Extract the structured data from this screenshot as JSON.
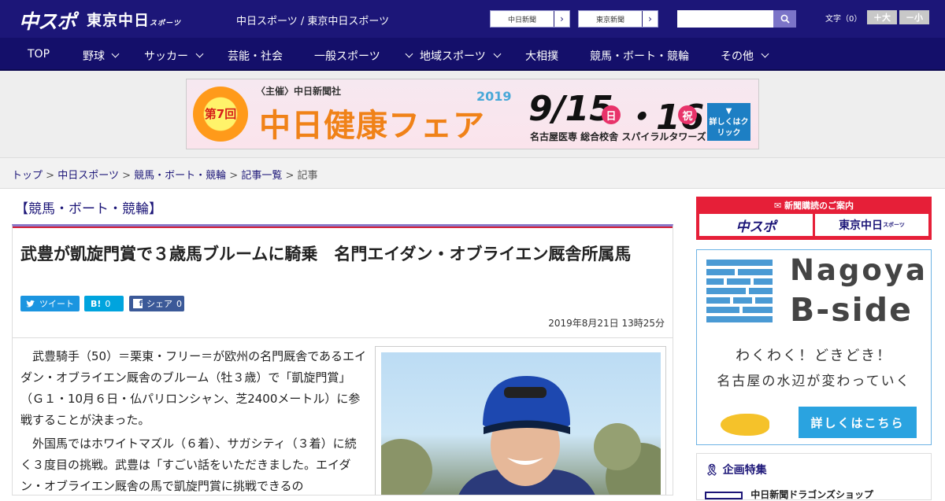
{
  "header": {
    "logo_chuspo": "中スポ",
    "logo_tokyo": "東京中日",
    "logo_tokyo_small": "スポーツ",
    "site_title": "中日スポーツ / 東京中日スポーツ",
    "paper_links": [
      "中日新聞",
      "東京新聞"
    ],
    "search_placeholder": "",
    "font_size_label": "文字（0）",
    "font_larger": "＋大",
    "font_smaller": "－小"
  },
  "nav": {
    "items": [
      "TOP",
      "野球",
      "サッカー",
      "芸能・社会",
      "一般スポーツ",
      "地域スポーツ",
      "大相撲",
      "競馬・ボート・競輪",
      "その他"
    ]
  },
  "banner": {
    "badge": "第7回",
    "host": "〈主催〉中日新聞社",
    "year": "2019",
    "title": "中日健康フェア",
    "date": "9/15",
    "day1": "日",
    "date2": "・16",
    "day2": "祝",
    "venue": "名古屋医専 総合校舎 スパイラルタワーズ",
    "cta": "詳しくはクリック"
  },
  "breadcrumb": {
    "items": [
      "トップ",
      "中日スポーツ",
      "競馬・ボート・競輪",
      "記事一覧"
    ],
    "current": "記事",
    "sep": ">"
  },
  "category": "【競馬・ボート・競輪】",
  "article": {
    "title": "武豊が凱旋門賞で３歳馬ブルームに騎乗　名門エイダン・オブライエン厩舎所属馬",
    "share_tweet": "ツイート",
    "share_hatena_icon": "B!",
    "share_hatena_count": "0",
    "share_fb": "シェア",
    "share_fb_count": "0",
    "date": "2019年8月21日 13時25分",
    "paragraphs": [
      "　武豊騎手（50）＝栗東・フリー＝が欧州の名門厩舎であるエイダン・オブライエン厩舎のブルーム（牡３歳）で「凱旋門賞」（Ｇ１・10月６日・仏パリロンシャン、芝2400メートル）に参戦することが決まった。",
      "　外国馬ではホワイトマズル（６着）、サガシティ（３着）に続く３度目の挑戦。武豊は「すごい話をいただきました。エイダン・オブライエン厩舎の馬で凱旋門賞に挑戦できるの"
    ]
  },
  "sidebar": {
    "subscribe_header": "新聞購読のご案内",
    "subscribe_a": "中スポ",
    "subscribe_b": "東京中日",
    "subscribe_b_small": "スポーツ",
    "ad_name1": "Nagoya",
    "ad_name2": "B-side",
    "ad_line1": "わくわく！どきどき！",
    "ad_line2": "名古屋の水辺が変わっていく",
    "ad_cta": "詳しくはこちら",
    "feature_header": "企画特集",
    "feature_item": "中日新聞ドラゴンズショップ"
  },
  "colors": {
    "header_bg": "#1c1678",
    "nav_bg": "#140f6a",
    "accent_red": "#d3223a",
    "twitter": "#1b95e0",
    "hatena": "#00a4de",
    "facebook": "#3b5998"
  }
}
